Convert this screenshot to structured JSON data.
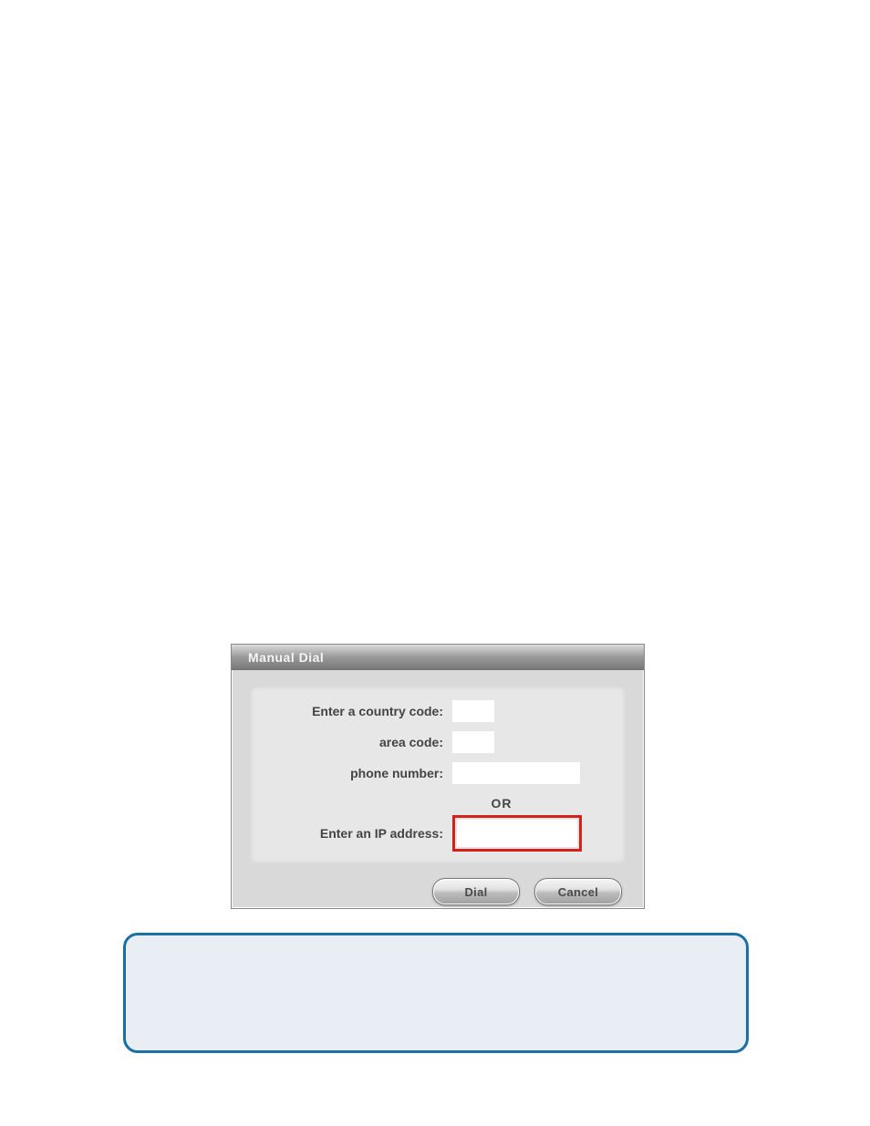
{
  "dialog": {
    "title": "Manual Dial",
    "labels": {
      "country_code": "Enter a country code:",
      "area_code": "area code:",
      "phone_number": "phone number:",
      "or": "OR",
      "ip_address": "Enter an IP address:"
    },
    "values": {
      "country_code": "",
      "area_code": "",
      "phone_number": "",
      "ip_address": ""
    },
    "buttons": {
      "dial": "Dial",
      "cancel": "Cancel"
    }
  },
  "callout": {
    "text": ""
  }
}
